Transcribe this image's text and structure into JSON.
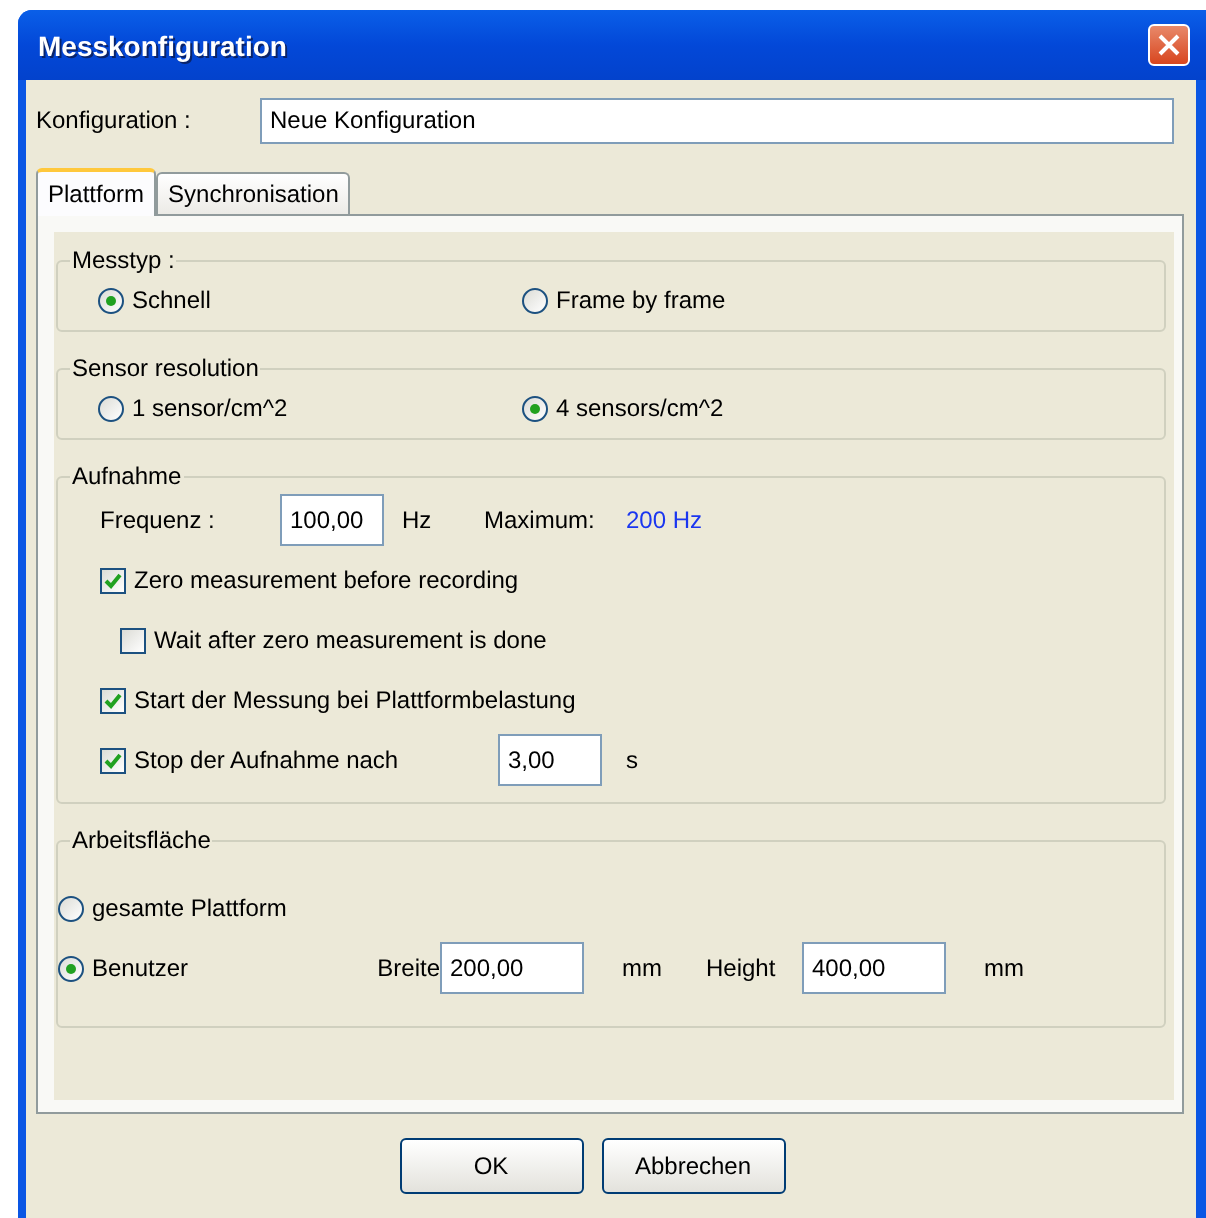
{
  "window": {
    "title": "Messkonfiguration"
  },
  "configuration": {
    "label": "Konfiguration :",
    "value": "Neue Konfiguration"
  },
  "tabs": [
    {
      "label": "Plattform",
      "selected": true
    },
    {
      "label": "Synchronisation",
      "selected": false
    }
  ],
  "messtyp": {
    "title": "Messtyp :",
    "options": [
      {
        "label": "Schnell",
        "selected": true
      },
      {
        "label": "Frame by frame",
        "selected": false
      }
    ]
  },
  "sensor_resolution": {
    "title": "Sensor resolution",
    "options": [
      {
        "label": "1 sensor/cm^2",
        "selected": false
      },
      {
        "label": "4 sensors/cm^2",
        "selected": true
      }
    ]
  },
  "aufnahme": {
    "title": "Aufnahme",
    "frequency": {
      "label": "Frequenz :",
      "value": "100,00",
      "unit": "Hz"
    },
    "maximum": {
      "label": "Maximum:",
      "value": "200 Hz"
    },
    "options": [
      {
        "label": "Zero measurement before recording",
        "checked": true,
        "children": [
          {
            "label": "Wait after zero measurement is done",
            "checked": false
          }
        ]
      },
      {
        "label": "Start der Messung bei Plattformbelastung",
        "checked": true
      },
      {
        "label": "Stop der Aufnahme nach",
        "checked": true,
        "value": "3,00",
        "unit": "s"
      }
    ]
  },
  "arbeitsflaeche": {
    "title": "Arbeitsfläche",
    "options": [
      {
        "label": "gesamte Plattform",
        "selected": false
      },
      {
        "label": "Benutzer",
        "selected": true
      }
    ],
    "fields": [
      {
        "label": "Breite",
        "value": "200,00",
        "unit": "mm"
      },
      {
        "label": "Height",
        "value": "400,00",
        "unit": "mm"
      }
    ]
  },
  "buttons": [
    "OK",
    "Abbrechen"
  ]
}
